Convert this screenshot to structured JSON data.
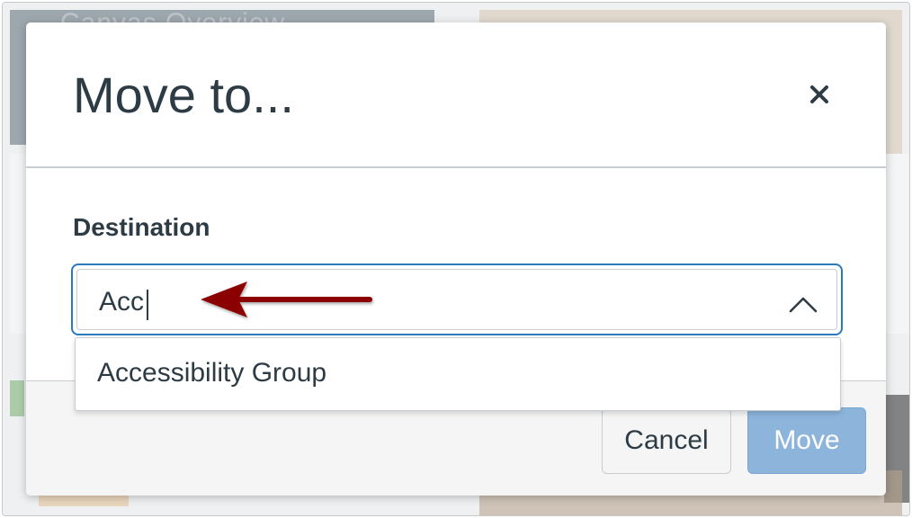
{
  "background": {
    "card_title": "Canvas Overview"
  },
  "dialog": {
    "title": "Move to...",
    "close_icon": "close-icon",
    "destination_label": "Destination",
    "destination_value": "Acc",
    "dropdown_icon": "chevron-up-icon",
    "options": [
      {
        "label": "Accessibility Group"
      }
    ]
  },
  "footer": {
    "cancel_label": "Cancel",
    "move_label": "Move"
  },
  "colors": {
    "text": "#2d3b45",
    "focus": "#2b7abc",
    "move_button": "#8db4db",
    "annotation_arrow": "#8b0000"
  }
}
